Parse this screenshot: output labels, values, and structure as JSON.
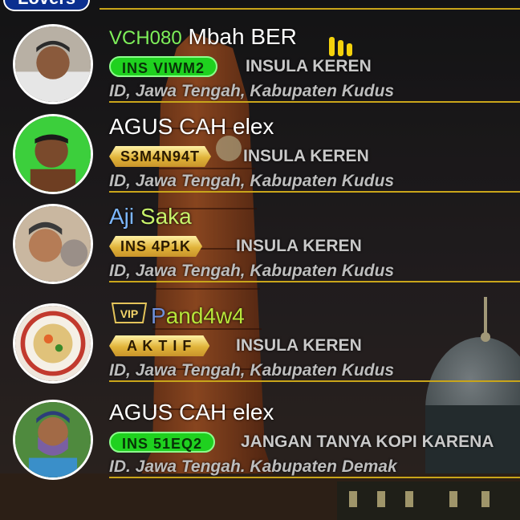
{
  "header": {
    "title": "Lovers"
  },
  "colors": {
    "accent_gold": "#c9a51a",
    "name_prefix_green": "#7ef05a",
    "badge_green": "#1fd11f",
    "header_blue": "#0b2f8f"
  },
  "rows": [
    {
      "prefix": "VCH080",
      "name": "Mbah BER",
      "badge": "INS  VIWM2",
      "badge_style": "green",
      "tagline": "INSULA KEREN",
      "location": "ID, Jawa Tengah, Kabupaten Kudus",
      "icon": "level-bars-icon"
    },
    {
      "prefix": "",
      "name": "AGUS CAH elex",
      "badge": "S3M4N94T",
      "badge_style": "gold",
      "tagline": "INSULA KEREN",
      "location": "ID, Jawa Tengah, Kabupaten Kudus"
    },
    {
      "prefix": "",
      "name_part1": "Aji",
      "name_part2": "Saka",
      "badge": "INS 4P1K",
      "badge_style": "gold",
      "tagline": "INSULA KEREN",
      "location": "ID, Jawa Tengah, Kabupaten Kudus"
    },
    {
      "prefix": "",
      "name_part1": "P",
      "name_part2": "and4w4",
      "badge": "A K T I F",
      "badge_style": "gold",
      "tagline": "INSULA KEREN",
      "location": "ID, Jawa Tengah, Kabupaten Kudus",
      "icon": "vip-badge-icon",
      "icon_text": "VIP"
    },
    {
      "prefix": "",
      "name": "AGUS CAH elex",
      "badge": "INS  51EQ2",
      "badge_style": "green",
      "tagline": "JANGAN TANYA KOPI KARENA",
      "location": "ID. Jawa Tengah. Kabupaten Demak"
    }
  ]
}
